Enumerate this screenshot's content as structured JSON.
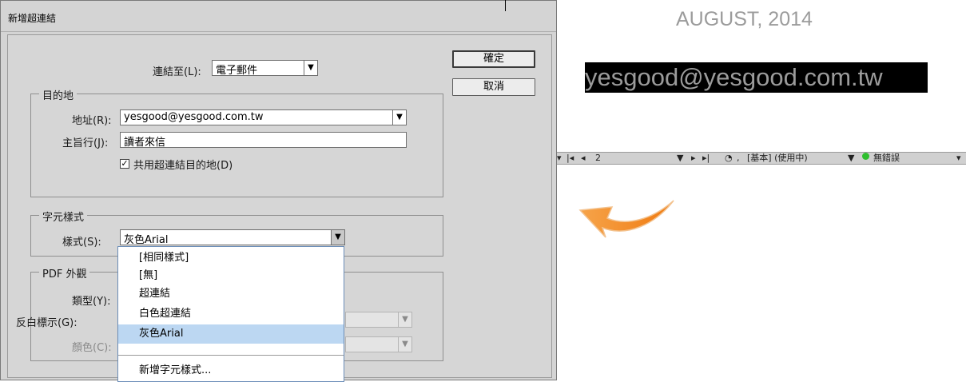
{
  "dialog": {
    "title": "新增超連結",
    "link_to": {
      "label": "連結至(L):",
      "value": "電子郵件"
    },
    "ok_button": "確定",
    "cancel_button": "取消",
    "destination": {
      "title": "目的地",
      "address_label": "地址(R):",
      "address_value": "yesgood@yesgood.com.tw",
      "subject_label": "主旨行(J):",
      "subject_value": "讀者來信",
      "shared_checkbox": {
        "checked": true,
        "label": "共用超連結目的地(D)"
      }
    },
    "char_style": {
      "title": "字元樣式",
      "style_label": "樣式(S):",
      "style_value": "灰色Arial"
    },
    "pdf_appearance": {
      "title": "PDF 外觀",
      "type_label": "類型(Y):",
      "highlight_label": "反白標示(G):",
      "color_label": "顏色(C):"
    },
    "style_dropdown": {
      "items": [
        "[相同樣式]",
        "[無]",
        "超連結",
        "白色超連結",
        "灰色Arial"
      ],
      "selected_index": 4,
      "new_style": "新增字元樣式..."
    }
  },
  "canvas": {
    "date_text": "AUGUST, 2014",
    "email_text": "yesgood@yesgood.com.tw"
  },
  "statusbar": {
    "page_number": "2",
    "style_text": "[基本] (使用中)",
    "error_status": "無錯誤"
  },
  "colors": {
    "dialog_bg": "#d4d4d4",
    "dropdown_selected": "#bcd7f2",
    "status_ok": "#2fbf2f",
    "arrow": "#f08a1c",
    "canvas_text_grey": "#9b9b9b"
  }
}
